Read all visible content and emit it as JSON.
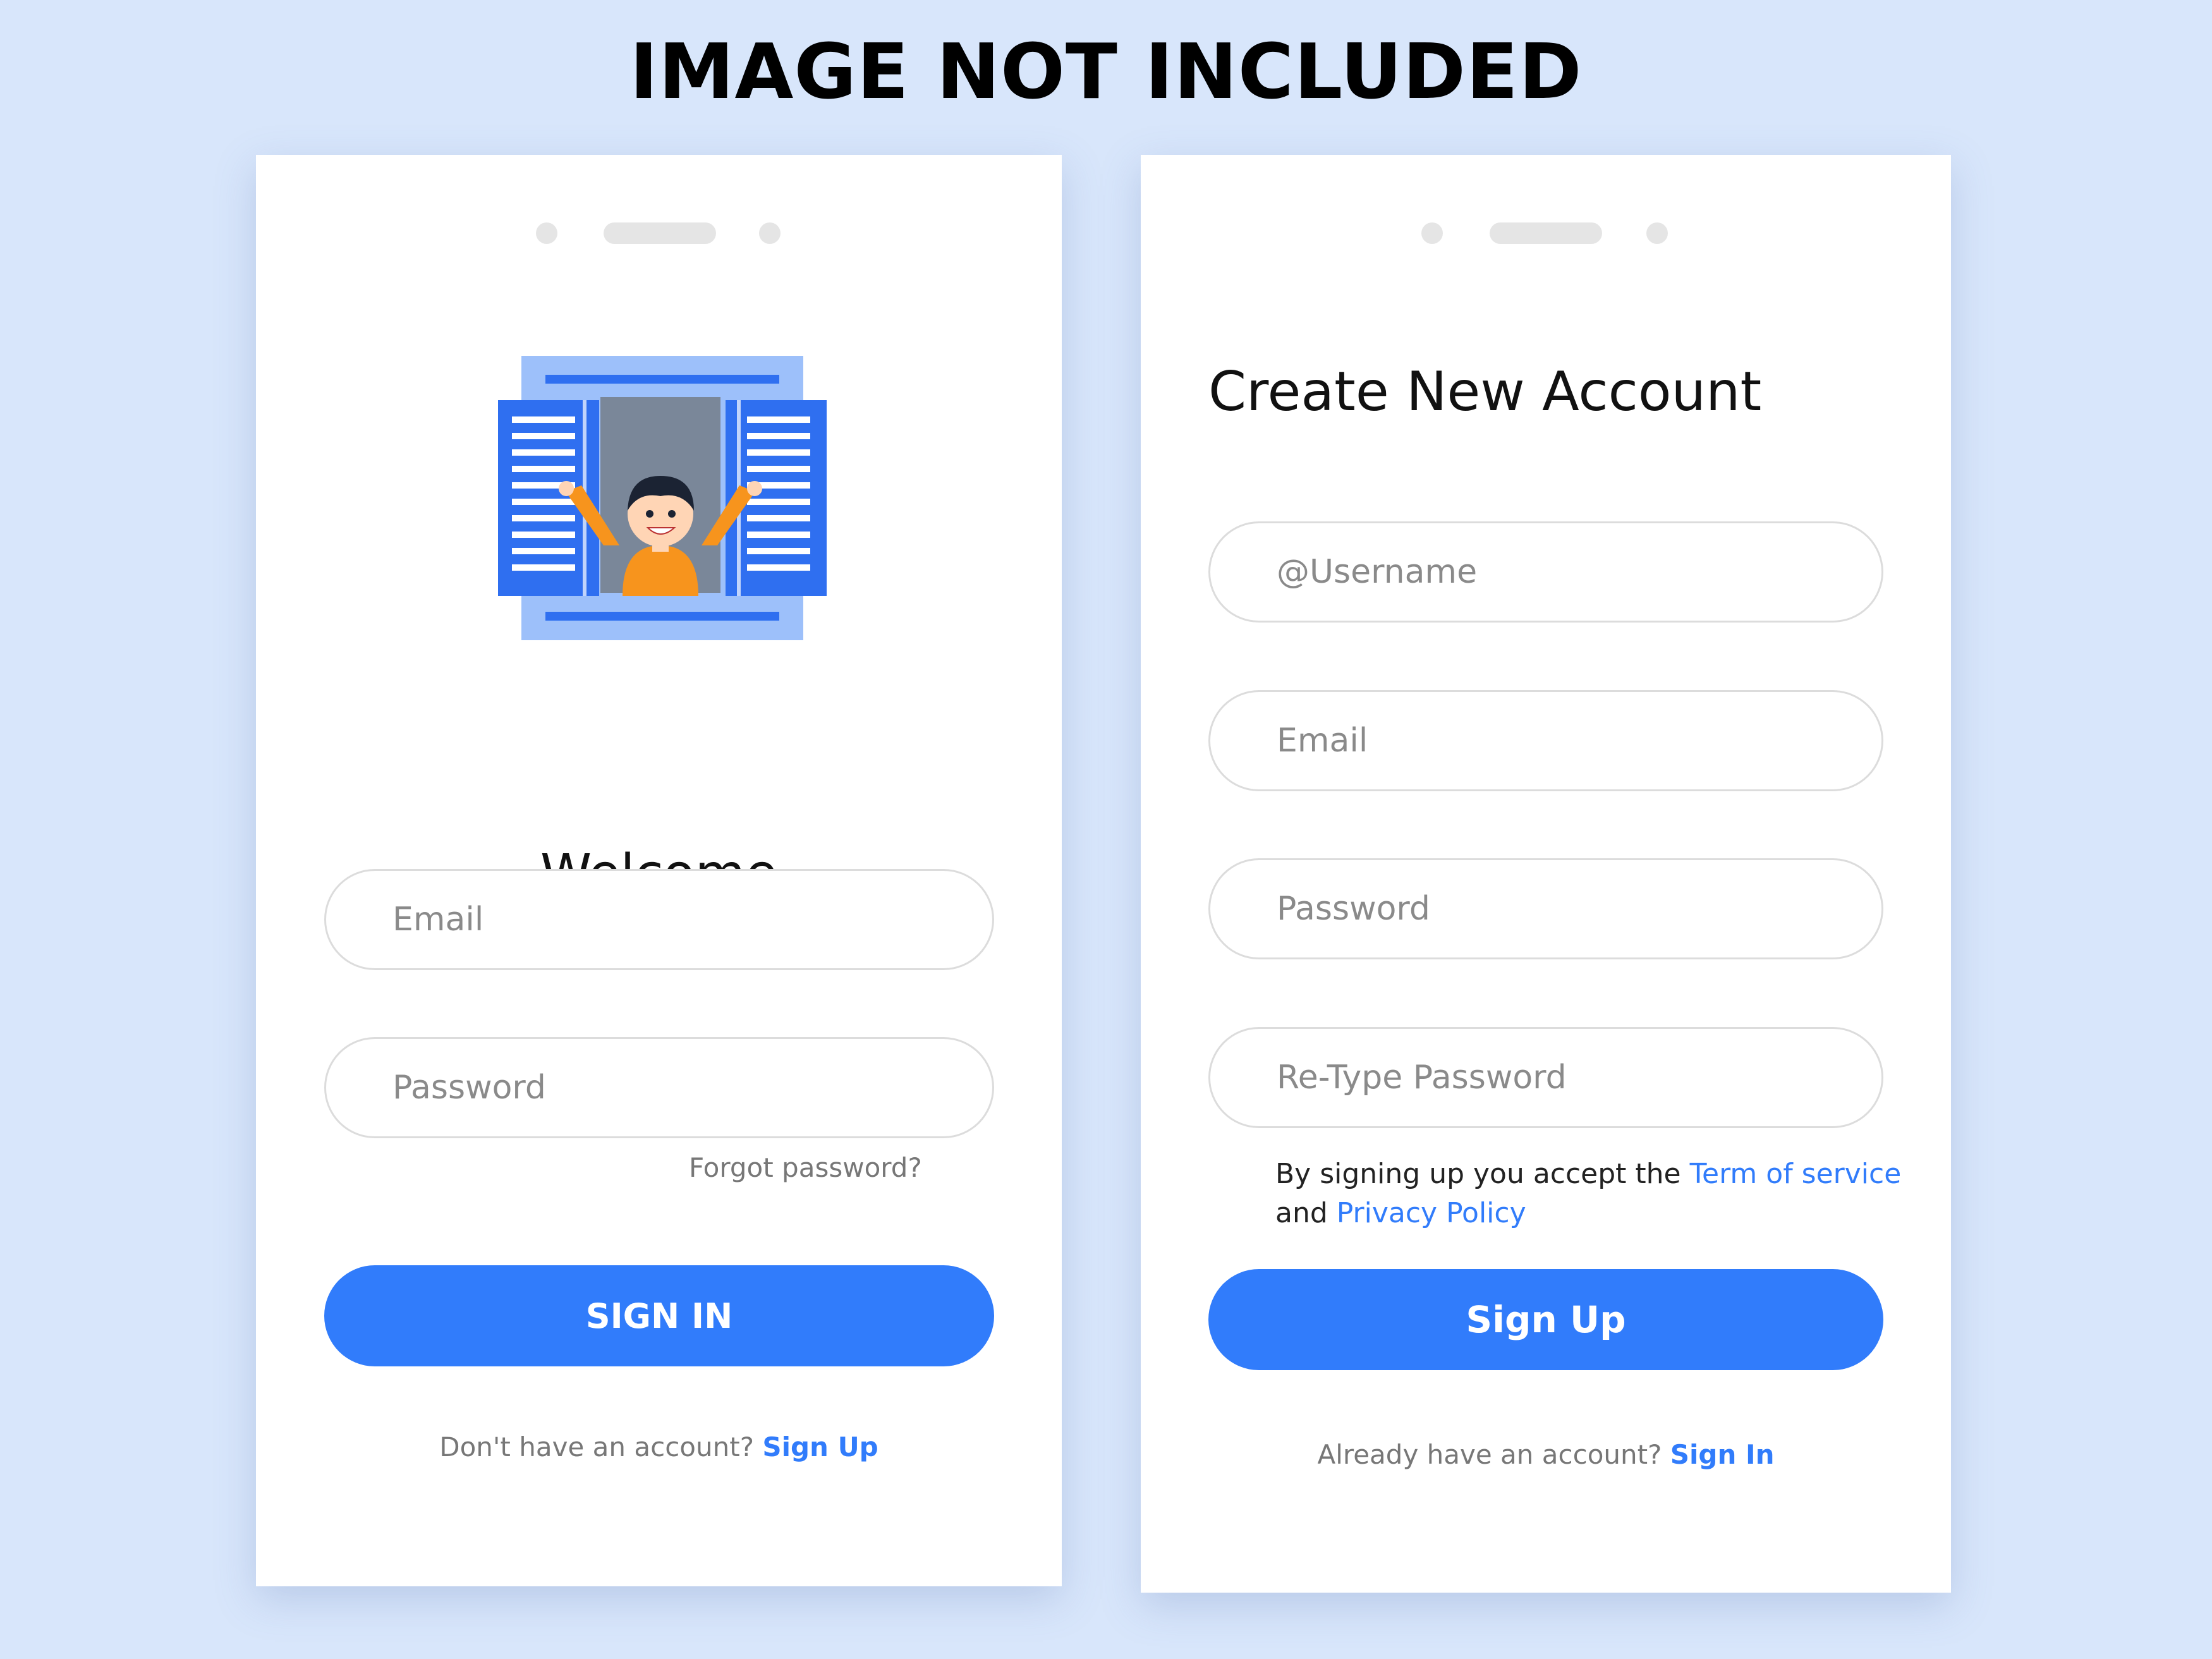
{
  "banner": {
    "text": "IMAGE NOT INCLUDED"
  },
  "signin": {
    "title": "Welcome",
    "email_placeholder": "Email",
    "password_placeholder": "Password",
    "forgot_label": "Forgot password?",
    "button_label": "SIGN IN",
    "footer_text": "Don't have an account?",
    "footer_link": "Sign Up",
    "illustration_icon": "person-waving-from-window-icon"
  },
  "signup": {
    "title": "Create New Account",
    "username_placeholder": "@Username",
    "email_placeholder": "Email",
    "password_placeholder": "Password",
    "retype_placeholder": "Re-Type Password",
    "terms_prefix": "By signing up you accept the",
    "terms_link": "Term of service",
    "terms_and": "and",
    "privacy_link": "Privacy Policy",
    "button_label": "Sign Up",
    "footer_text": "Already have an account?",
    "footer_link": "Sign In"
  },
  "colors": {
    "background": "#d8e6fb",
    "accent": "#317cfb",
    "card": "#ffffff",
    "field_border": "#dcdcdc"
  }
}
